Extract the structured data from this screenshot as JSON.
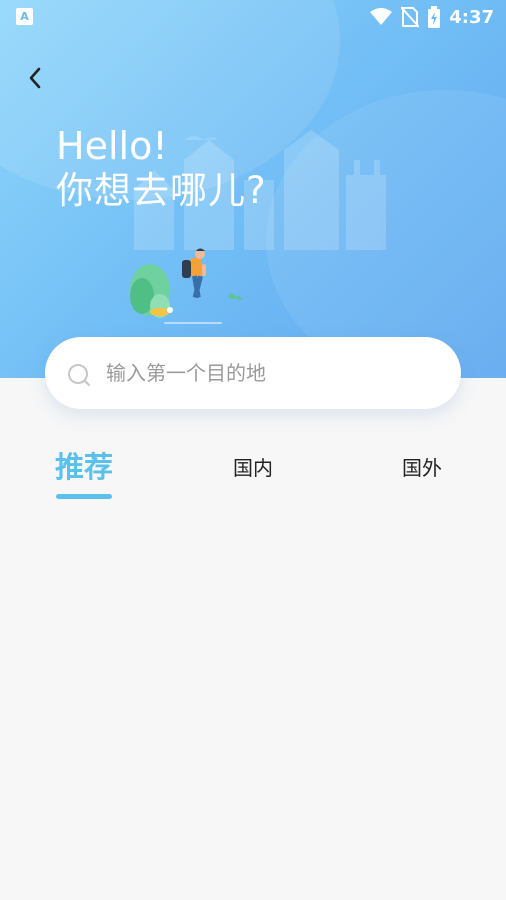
{
  "status_bar": {
    "app_badge": "A",
    "time": "4:37",
    "icons": [
      "wifi-icon",
      "no-sim-icon",
      "battery-charging-icon"
    ]
  },
  "header": {
    "back_icon": "chevron-left-icon",
    "greeting_line1": "Hello!",
    "greeting_line2": "你想去哪儿?"
  },
  "search": {
    "placeholder": "输入第一个目的地",
    "value": "",
    "icon": "search-icon"
  },
  "tabs": [
    {
      "label": "推荐",
      "active": true
    },
    {
      "label": "国内",
      "active": false
    },
    {
      "label": "国外",
      "active": false
    }
  ],
  "colors": {
    "accent": "#5bc0ec",
    "hero_start": "#8fd6fb",
    "hero_end": "#5fa8ef",
    "page_bg": "#f7f7f7"
  }
}
